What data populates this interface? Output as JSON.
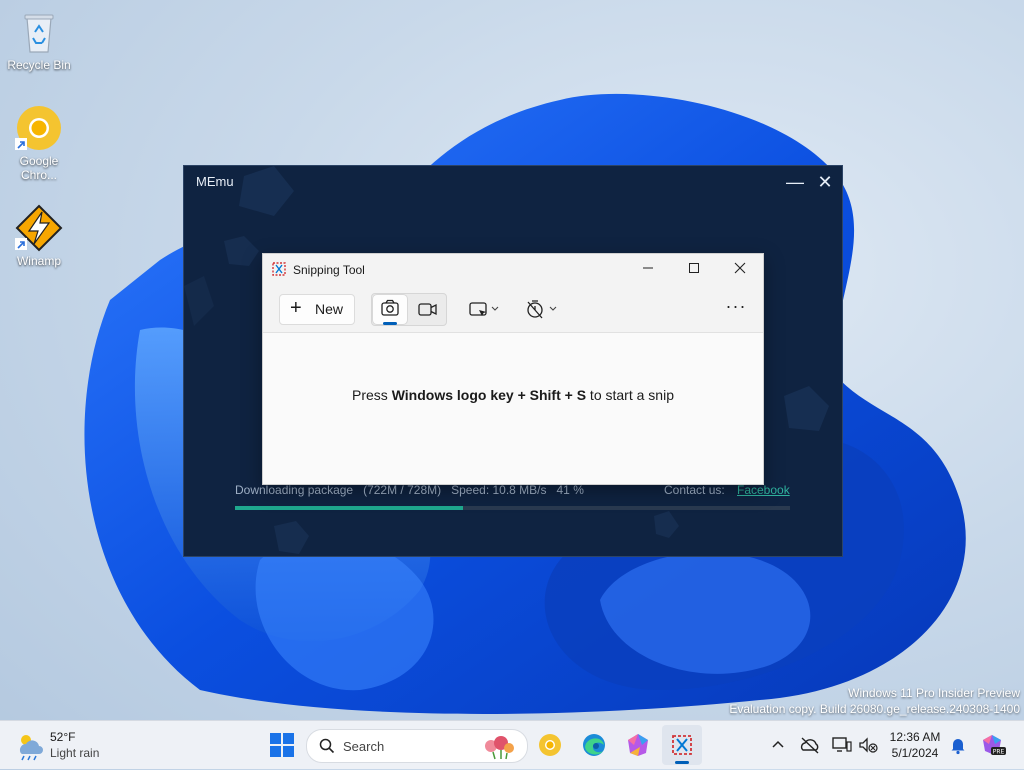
{
  "desktop": {
    "icons": [
      {
        "label": "Recycle Bin"
      },
      {
        "label": "Google\nChro..."
      },
      {
        "label": "Winamp"
      }
    ],
    "watermark": {
      "line1": "Windows 11 Pro Insider Preview",
      "line2": "Evaluation copy. Build 26080.ge_release.240308-1400"
    }
  },
  "memu": {
    "title": "MEmu",
    "minimize_glyph": "—",
    "close_glyph": "✕",
    "status_text": "Downloading package   (722M / 728M)   Speed: 10.8 MB/s   41 %",
    "progress_percent": 41,
    "contact_label": "Contact us:",
    "contact_link": "Facebook"
  },
  "snipping_tool": {
    "title": "Snipping Tool",
    "new_label": "New",
    "hint_prefix": "Press ",
    "hint_bold1": "Windows logo key + Shift + S",
    "hint_suffix": " to start a snip",
    "more_glyph": "···"
  },
  "taskbar": {
    "weather_temp": "52°F",
    "weather_condition": "Light rain",
    "search_label": "Search",
    "clock_time": "12:36 AM",
    "clock_date": "5/1/2024"
  },
  "colors": {
    "accent": "#005fb8",
    "memu_bg": "#0f2341",
    "progress": "#1fa88e",
    "link": "#2fb39e"
  }
}
